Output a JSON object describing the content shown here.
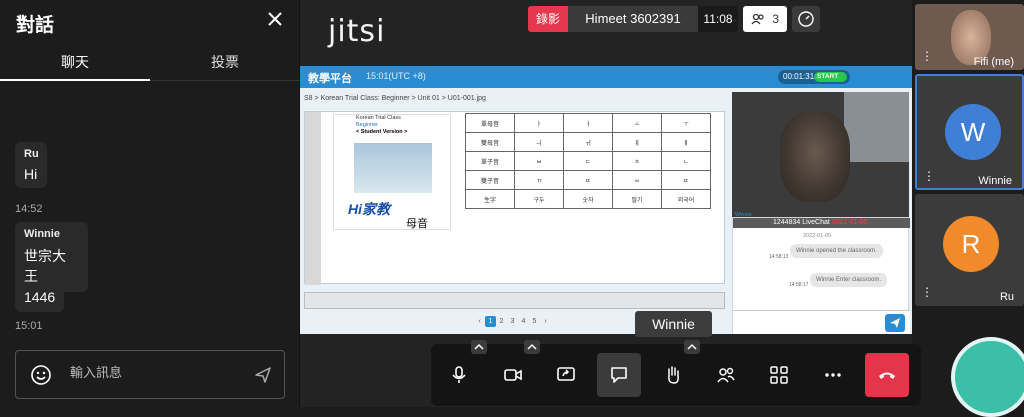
{
  "chat": {
    "title": "對話",
    "tabs": [
      "聊天",
      "投票"
    ],
    "messages": [
      {
        "sender": "Ru",
        "text": "Hi",
        "time": "14:52"
      },
      {
        "sender": "Winnie",
        "text": "世宗大王",
        "time": ""
      },
      {
        "sender": "",
        "text": "1446",
        "time": "15:01"
      }
    ],
    "input_placeholder": "輸入訊息"
  },
  "header": {
    "logo": "jitsi",
    "recording_label": "錄影",
    "room_name": "Himeet 3602391",
    "time": "11:08",
    "participant_count": "3"
  },
  "shared_screen": {
    "brand": "教學平台",
    "timezone": "15:01(UTC +8)",
    "timer": "00:01:31",
    "start_label": "START",
    "breadcrumb": "S8 > Korean Trial Class: Beginner > Unit 01 > U01-001.jpg",
    "lesson": {
      "line1": "Korean Trial Class",
      "line2": "Beginner",
      "line3": "< Student Version >",
      "logo": "Hi家教",
      "subtitle": "母音"
    },
    "hangul_table": [
      [
        "單母音",
        "ㅏ",
        "ㅓ",
        "ㅗ",
        "ㅜ"
      ],
      [
        "雙母音",
        "ㅢ",
        "ㅟ",
        "ㅖ",
        "ㅒ"
      ],
      [
        "單子音",
        "ㅂ",
        "ㄷ",
        "ㅊ",
        "ㄴ"
      ],
      [
        "雙子音",
        "ㄲ",
        "ㄸ",
        "ㅆ",
        "ㄸ"
      ],
      [
        "生字",
        "구두",
        "숫자",
        "딸기",
        "외국어"
      ]
    ],
    "pages": [
      "1",
      "2",
      "3",
      "4",
      "5"
    ],
    "livechat": {
      "tag": "Winnie",
      "header_prefix": "1244834 LiveChat",
      "header_date": "2022-01-05",
      "date": "2022-01-05",
      "messages": [
        {
          "text": "Winnie opened the classroom.",
          "time": "14:58:13"
        },
        {
          "text": "Winnie Enter classroom.",
          "time": "14:58:17"
        }
      ]
    }
  },
  "speaker_tooltip": "Winnie",
  "filmstrip": [
    {
      "name": "Fifi (me)",
      "initial": "",
      "color": "#8b6a55"
    },
    {
      "name": "Winnie",
      "initial": "W",
      "color": "#3f7fd6"
    },
    {
      "name": "Ru",
      "initial": "R",
      "color": "#f08a2a"
    }
  ],
  "toolbar_icons": [
    "microphone-icon",
    "camera-icon",
    "screen-share-icon",
    "chat-icon",
    "raise-hand-icon",
    "participants-icon",
    "tile-view-icon",
    "more-icon",
    "hangup-icon"
  ]
}
